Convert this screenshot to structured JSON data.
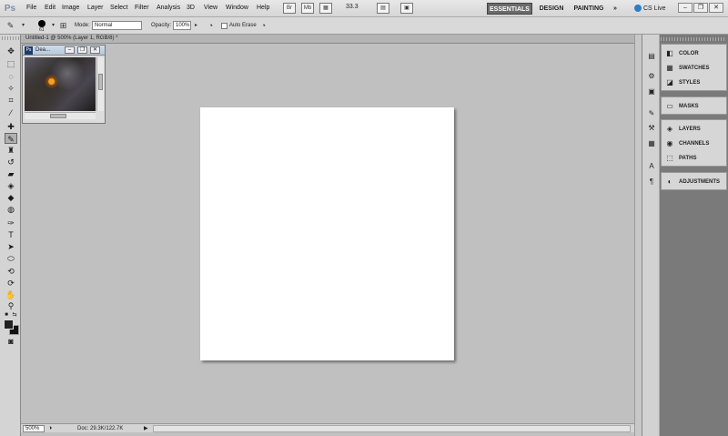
{
  "app": {
    "logo": "Ps"
  },
  "menu": [
    "File",
    "Edit",
    "Image",
    "Layer",
    "Select",
    "Filter",
    "Analysis",
    "3D",
    "View",
    "Window",
    "Help"
  ],
  "menubar_icons": {
    "bridge": "Br",
    "minibridge": "Mb",
    "zoom": "33.3"
  },
  "workspaces": {
    "essentials": "ESSENTIALS",
    "design": "DESIGN",
    "painting": "PAINTING",
    "more": "»"
  },
  "cs_live": "CS Live",
  "window_controls": {
    "minimize": "–",
    "restore": "❐",
    "close": "✕"
  },
  "options": {
    "brush_size": "61",
    "mode_label": "Mode:",
    "mode_value": "Normal",
    "opacity_label": "Opacity:",
    "opacity_value": "100%",
    "auto_erase_label": "Auto Erase"
  },
  "document": {
    "tab_label": "Untitled-1 @ 500% (Layer 1, RGB/8) *"
  },
  "navigator": {
    "title": "Dea..."
  },
  "status": {
    "zoom": "500%",
    "doc": "Doc: 29.3K/122.7K"
  },
  "panels": {
    "group1": [
      "COLOR",
      "SWATCHES",
      "STYLES"
    ],
    "group2": [
      "MASKS"
    ],
    "group3": [
      "LAYERS",
      "CHANNELS",
      "PATHS"
    ],
    "group4": [
      "ADJUSTMENTS"
    ]
  },
  "colors": {
    "foreground": "#222222",
    "background": "#111111",
    "workspace_active": "#6b6b6b"
  }
}
